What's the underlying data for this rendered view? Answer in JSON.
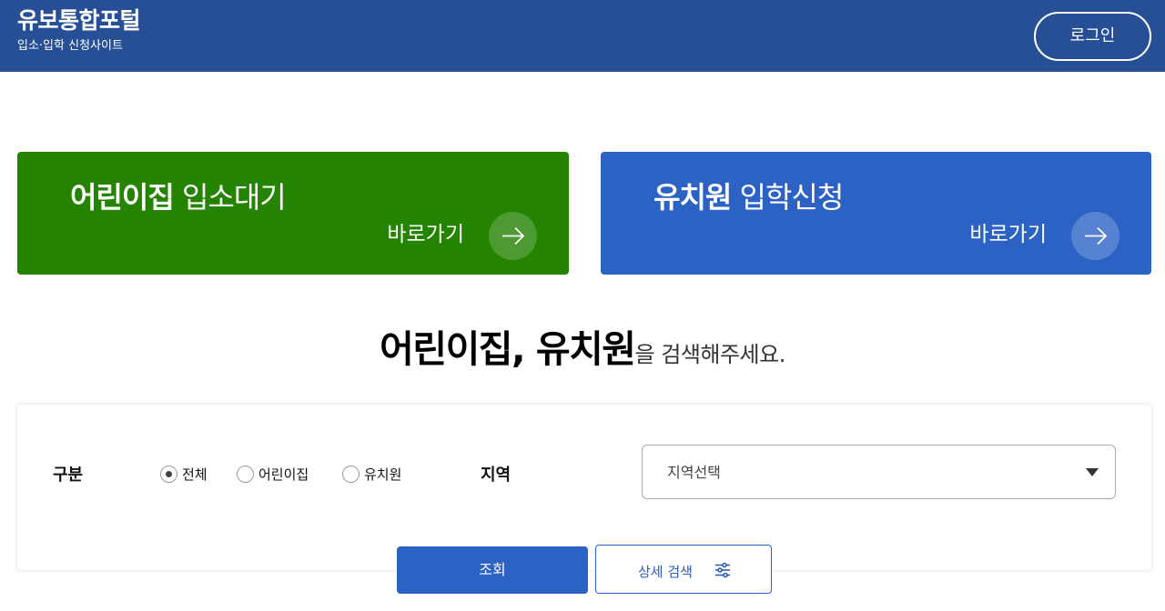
{
  "header": {
    "title": "유보통합포털",
    "subtitle": "입소·입학 신청사이트",
    "login_label": "로그인"
  },
  "cards": {
    "daycare": {
      "title_bold": "어린이집",
      "title_light": "입소대기",
      "go_label": "바로가기",
      "icon": "arrow-right-icon"
    },
    "kinder": {
      "title_bold": "유치원",
      "title_light": "입학신청",
      "go_label": "바로가기",
      "icon": "arrow-right-icon"
    }
  },
  "headline": {
    "bold": "어린이집, 유치원",
    "light": "을 검색해주세요."
  },
  "search": {
    "category_label": "구분",
    "options": [
      {
        "label": "전체",
        "selected": true
      },
      {
        "label": "어린이집",
        "selected": false
      },
      {
        "label": "유치원",
        "selected": false
      }
    ],
    "region_label": "지역",
    "region_value": "지역선택",
    "submit_label": "조회",
    "detail_label": "상세 검색"
  },
  "colors": {
    "header_bg": "#264f96",
    "daycare_green": "#248400",
    "kinder_blue": "#2b62c4"
  }
}
